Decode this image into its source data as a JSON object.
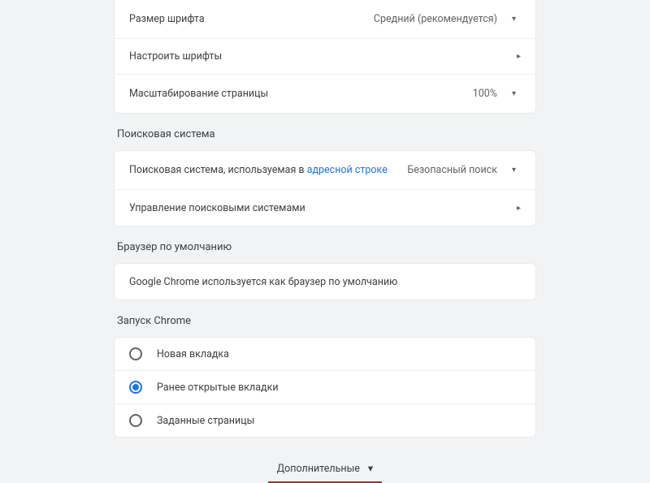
{
  "appearance": {
    "font_size_label": "Размер шрифта",
    "font_size_value": "Средний (рекомендуется)",
    "customize_fonts_label": "Настроить шрифты",
    "page_zoom_label": "Масштабирование страницы",
    "page_zoom_value": "100%"
  },
  "search_engine": {
    "section_title": "Поисковая система",
    "used_in_label_prefix": "Поисковая система, используемая в ",
    "address_bar_link": "адресной строке",
    "value": "Безопасный поиск",
    "manage_label": "Управление поисковыми системами"
  },
  "default_browser": {
    "section_title": "Браузер по умолчанию",
    "status_text": "Google Chrome используется как браузер по умолчанию"
  },
  "on_startup": {
    "section_title": "Запуск Chrome",
    "options": [
      {
        "label": "Новая вкладка",
        "checked": false
      },
      {
        "label": "Ранее открытые вкладки",
        "checked": true
      },
      {
        "label": "Заданные страницы",
        "checked": false
      }
    ]
  },
  "advanced_label": "Дополнительные"
}
